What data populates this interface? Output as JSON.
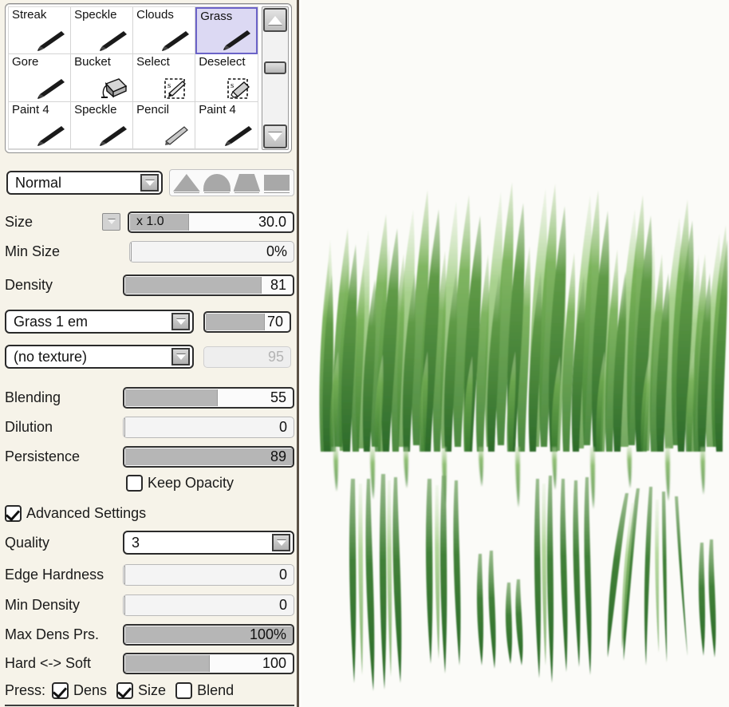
{
  "brush_presets": {
    "rows": [
      [
        {
          "label": "Streak",
          "icon": "brush-icon",
          "selected": false
        },
        {
          "label": "Speckle",
          "icon": "brush-icon",
          "selected": false
        },
        {
          "label": "Clouds",
          "icon": "brush-icon",
          "selected": false
        },
        {
          "label": "Grass",
          "icon": "brush-icon",
          "selected": true
        }
      ],
      [
        {
          "label": "Gore",
          "icon": "brush-icon",
          "selected": false
        },
        {
          "label": "Bucket",
          "icon": "bucket-icon",
          "selected": false
        },
        {
          "label": "Select",
          "icon": "select-pen-icon",
          "selected": false
        },
        {
          "label": "Deselect",
          "icon": "deselect-eraser-icon",
          "selected": false
        }
      ],
      [
        {
          "label": "Paint 4",
          "icon": "brush-icon",
          "selected": false
        },
        {
          "label": "Speckle",
          "icon": "brush-icon",
          "selected": false
        },
        {
          "label": "Pencil",
          "icon": "pencil-icon",
          "selected": false
        },
        {
          "label": "Paint 4",
          "icon": "brush-icon",
          "selected": false
        }
      ]
    ],
    "scrollbar": {
      "up_icon": "scroll-up-arrow-icon",
      "down_icon": "scroll-down-arrow-icon",
      "thumb": "scrollbar-thumb"
    }
  },
  "blend_mode": {
    "value": "Normal",
    "arrow_icon": "chevron-down-icon"
  },
  "tip_shapes": [
    {
      "name": "cone-tip"
    },
    {
      "name": "dome-tip"
    },
    {
      "name": "trapezoid-tip"
    },
    {
      "name": "square-tip"
    }
  ],
  "settings": {
    "size": {
      "label": "Size",
      "multiplier": "x 1.0",
      "value": "30.0",
      "fill_percent": 38,
      "dropdown_icon": "chevron-down-icon"
    },
    "min_size": {
      "label": "Min Size",
      "value": "0%",
      "fill_percent": 0
    },
    "density": {
      "label": "Density",
      "value": "81",
      "fill_percent": 81
    },
    "shape": {
      "value": "Grass 1 em",
      "arrow_icon": "chevron-down-icon",
      "slider_value": "70",
      "slider_fill_percent": 70
    },
    "texture": {
      "value": "(no texture)",
      "arrow_icon": "chevron-down-icon",
      "slider_value": "95",
      "slider_fill_percent": 0,
      "disabled": true
    },
    "blending": {
      "label": "Blending",
      "value": "55",
      "fill_percent": 55
    },
    "dilution": {
      "label": "Dilution",
      "value": "0",
      "fill_percent": 0
    },
    "persistence": {
      "label": "Persistence",
      "value": "89",
      "fill_percent": 100
    },
    "keep_opacity": {
      "label": "Keep Opacity",
      "checked": false
    },
    "advanced_settings": {
      "label": "Advanced Settings",
      "checked": true
    },
    "quality": {
      "label": "Quality",
      "value": "3",
      "arrow_icon": "chevron-down-icon"
    },
    "edge_hardness": {
      "label": "Edge Hardness",
      "value": "0",
      "fill_percent": 0
    },
    "min_density": {
      "label": "Min Density",
      "value": "0",
      "fill_percent": 0
    },
    "max_dens_prs": {
      "label": "Max Dens Prs.",
      "value": "100%",
      "fill_percent": 100
    },
    "hard_soft": {
      "label": "Hard <-> Soft",
      "value": "100",
      "fill_percent": 50
    },
    "pressure": {
      "label": "Press:",
      "options": [
        {
          "label": "Dens",
          "checked": true
        },
        {
          "label": "Size",
          "checked": true
        },
        {
          "label": "Blend",
          "checked": false
        }
      ]
    }
  },
  "canvas": {
    "name": "grass-painting-canvas",
    "background_color": "#fbfbf8",
    "stroke_color_dark": "#2f6b2c",
    "stroke_color_mid": "#5a9e3f",
    "stroke_color_light": "#a8cf8a"
  }
}
